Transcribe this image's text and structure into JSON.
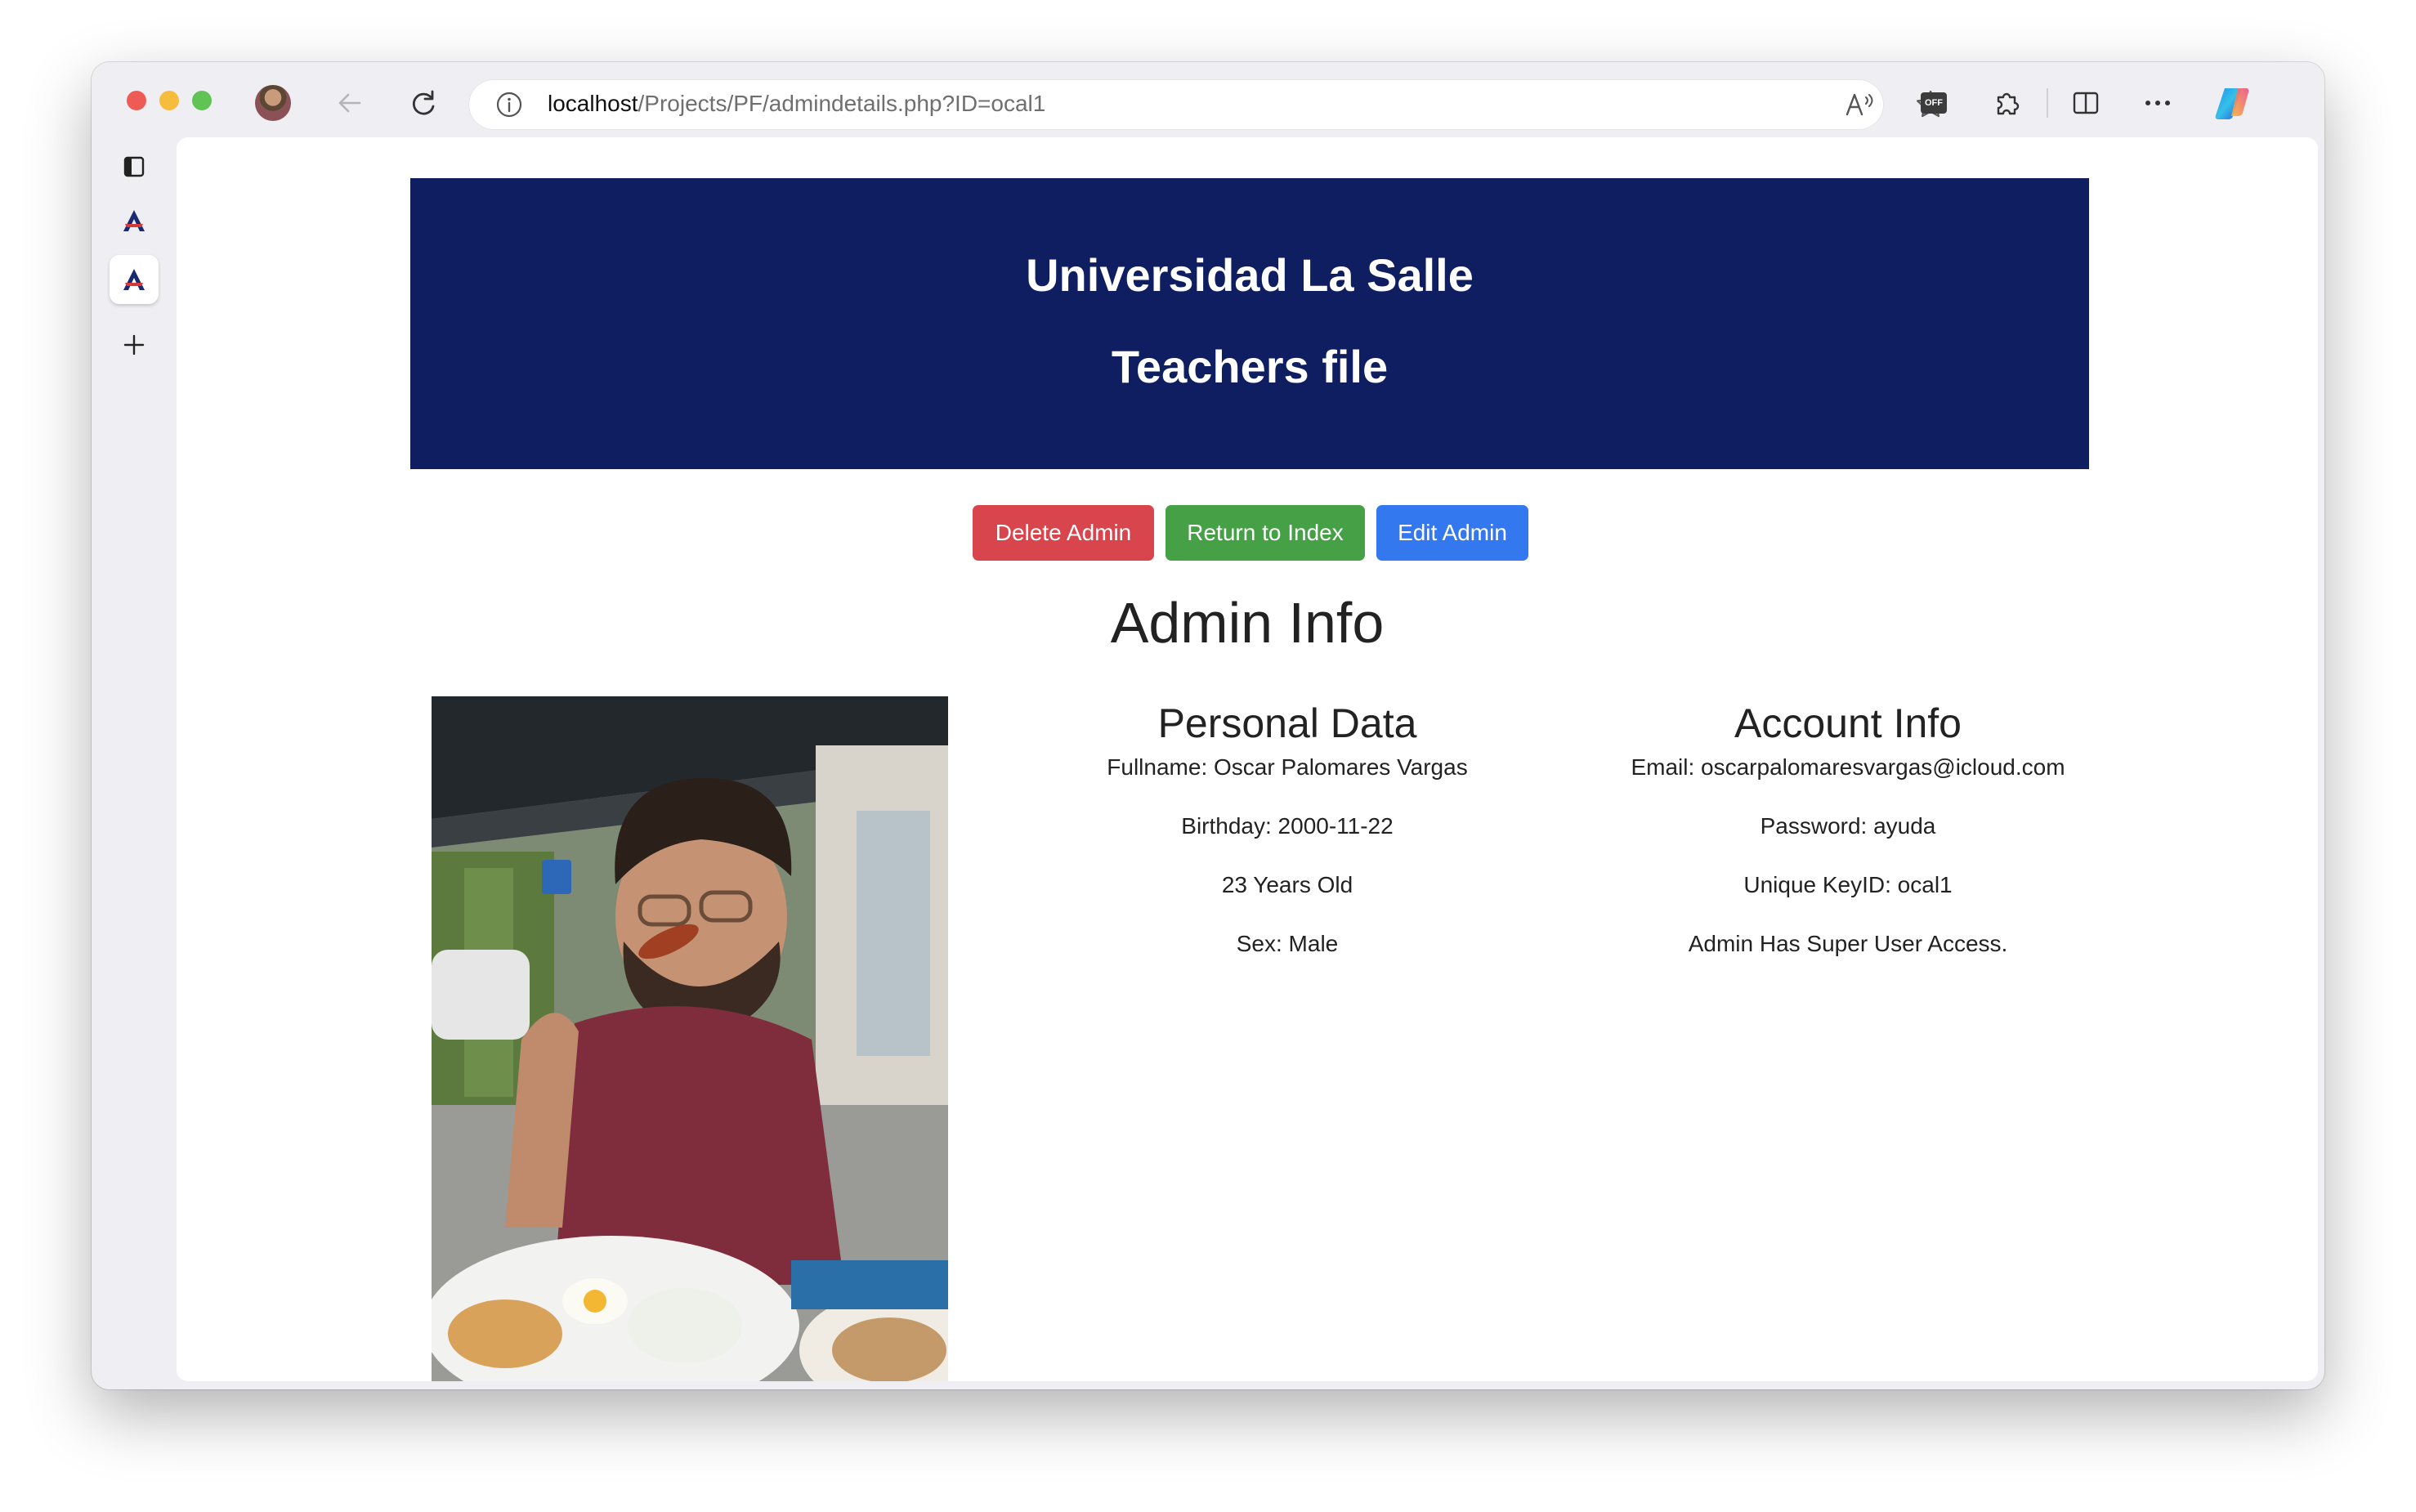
{
  "browser": {
    "url_host": "localhost",
    "url_path": "/Projects/PF/admindetails.php?ID=ocal1",
    "read_aloud_icon": "A⁵",
    "extension_badge": "OFF",
    "more_label": "···"
  },
  "icons": [
    "back-arrow-icon",
    "reload-icon",
    "info-icon",
    "read-aloud-icon",
    "favorite-star-icon",
    "extension-off-icon",
    "puzzle-icon",
    "split-screen-icon",
    "more-icon",
    "copilot-icon",
    "tab-actions-icon",
    "site-favicon-icon",
    "new-tab-plus-icon"
  ],
  "header": {
    "title": "Universidad La Salle",
    "subtitle": "Teachers file"
  },
  "actions": {
    "delete_label": "Delete Admin",
    "return_label": "Return to Index",
    "edit_label": "Edit Admin",
    "delete_color": "#d9454c",
    "return_color": "#45a046",
    "edit_color": "#3478f0"
  },
  "page_title": "Admin Info",
  "personal": {
    "heading": "Personal Data",
    "fullname": "Fullname: Oscar Palomares Vargas",
    "birthday": "Birthday: 2000-11-22",
    "age": "23 Years Old",
    "sex": "Sex: Male"
  },
  "account": {
    "heading": "Account Info",
    "email": "Email: oscarpalomaresvargas@icloud.com",
    "password": "Password: ayuda",
    "key": "Unique KeyID: ocal1",
    "access": "Admin Has Super User Access."
  },
  "colors": {
    "banner": "#0e1e60"
  }
}
